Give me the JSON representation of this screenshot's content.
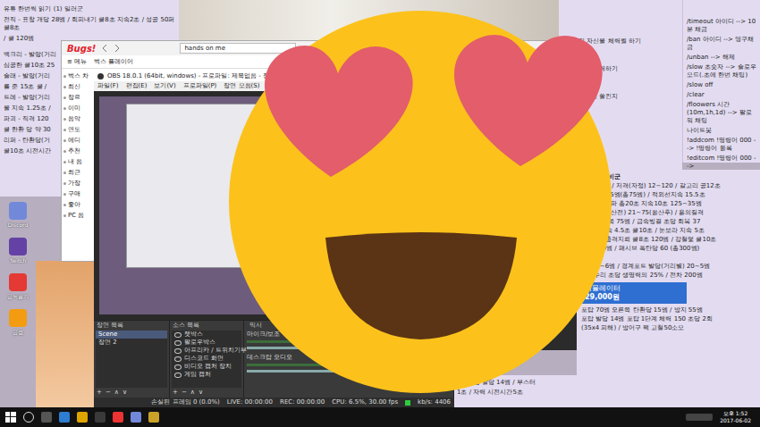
{
  "desktop": {
    "icons": [
      {
        "label": "Discord",
        "color": "#7289da"
      },
      {
        "label": "Twitch",
        "color": "#6441a4"
      },
      {
        "label": "곰녹음기",
        "color": "#e53935"
      },
      {
        "label": "곰캠",
        "color": "#f39c12"
      }
    ]
  },
  "left_note": {
    "top_lines": [
      "유튜 한번씩 읽기 (1) 일러군",
      "전직 - 표창 개당 28엠 / 회피내기 쿨8초 지속2초 / 성공 50퍼 쿨8초",
      "/ 쿨 120엠"
    ],
    "cut_lines": [
      "백크리 - 발랑(거리",
      "심공한 쿨10초 25",
      "슬래 - 발랑(거리",
      "를 준 15초 쿨 /",
      "트레 - 발랑(거리",
      "을 지속 1.25초 /",
      "파괴 - 직격 120",
      "쿨 한환 당 약 30",
      "리퍼 - 탄환당(거",
      "쿨10초 시전시간"
    ]
  },
  "memo_note": {
    "lines": [
      "해 까지 자신을 체력월 하기",
      "표를 향해 노력하기",
      "의 아일리지 쏠킨지"
    ]
  },
  "commands_note": {
    "lines": [
      "/timeout 아이디 --> 10분 채금",
      "/ban 아이디 --> 영구채금",
      "/unban --> 해제",
      "/slow 초숫자 --> 슬로우모드(.초에 한번 채팅)",
      "/slow off",
      "/clear",
      "/floowers 시간(10m,1h,1d) --> 팔로워 채팅",
      "나이트봇",
      "!addcom !명령어 000 --> !명령어 등록",
      "!editcom !명령어 000 -->"
    ]
  },
  "browser": {
    "logo": "Bugs!",
    "search": "hands on me",
    "menu": [
      "≡ 메뉴",
      "벅스 플레이어"
    ],
    "sidebar": [
      "벅스 차",
      "최신",
      "장르",
      "이미",
      "음악",
      "연도",
      "에디",
      "추천",
      "내 음",
      "최근",
      "가장",
      "구매",
      "좋아",
      "PC 음"
    ]
  },
  "obs": {
    "title": "OBS 18.0.1 (64bit, windows) - 프로파일: 제목없음 - 장면: 장면",
    "menu": [
      "파일(F)",
      "편집(E)",
      "보기(V)",
      "프로파일(P)",
      "장면 모음(S)",
      "도구(T)"
    ],
    "scenes": {
      "header": "장면 목록",
      "items": [
        {
          "label": "Scene",
          "selected": true
        },
        {
          "label": "장면 2",
          "selected": false
        }
      ]
    },
    "sources": {
      "header": "소스 목록",
      "items": [
        {
          "label": "챗박스",
          "visible": true
        },
        {
          "label": "팔로우박스",
          "visible": true
        },
        {
          "label": "아프리카 / 트위치기부",
          "visible": true
        },
        {
          "label": "디스코드 화면",
          "visible": true
        },
        {
          "label": "비디오 캡처 장치",
          "visible": true
        },
        {
          "label": "게임 캡처",
          "visible": true
        }
      ]
    },
    "mixer": {
      "header": "믹서",
      "channels": [
        {
          "name": "마이크/보조",
          "level": 0.72,
          "muted": false
        },
        {
          "name": "데스크탑 오디오",
          "level": 0.72,
          "muted": false
        }
      ]
    },
    "list_buttons": [
      "+",
      "−",
      "∧",
      "∨"
    ],
    "status": {
      "dropped": "손실된 프레임 0 (0.0%)",
      "live": "LIVE: 00:00:00",
      "rec": "REC: 00:00:00",
      "cpu": "CPU: 6.5%, 30.00 fps",
      "kbps": "kb/s: 4406"
    }
  },
  "guide_note": {
    "title": "티 (3) 수비군",
    "lines": [
      "발당 12엠 / 저격(자정) 12~120 / 갈고리 공12초",
      "5초 초당15엠(총75엠) / 적외선지속 15.5초",
      "5~29 / 공파 총20초 지속10초 125~35엠",
      "5~125(응산전) 21~75(응산후) / 용의질격",
      "5엠, 오른쪽 75엠 / 급속빙결 초당 회복 37",
      "/ 빙벽 지속 4.5초 쿨10초 / 눈보라 지속 5초",
      "120엠 / 충격지뢰 쿨8초 120엠 / 강철덫 쿨10초",
      "(2초) 80엠 / 패시브 폭탄당 60 (총300엠)",
      "600엠",
      "엠) 20~6엠 / 경계포트 발당(거리별) 20~5엠",
      "자가수리 초당 생명력의 25% / 전차 200엠"
    ],
    "banner": {
      "title": "시뮬레이터",
      "price": "29,000원"
    },
    "more_lines": [
      "포탑 70엠 오른쪽 탄환당 15엠 / 방지 55엠",
      "포탑 발당 14엠 포탑 1단계 체력 150 초당 2회",
      "(35x4 피해) / 방어구 팩 고철50소모"
    ]
  },
  "bottom_note": {
    "lines": [
      "/ 완선총 발당 14엠 / 부스터",
      "1초 / 자력 시전시간5초"
    ]
  },
  "taskbar": {
    "time": "오후 1:52",
    "date": "2017-06-02"
  }
}
